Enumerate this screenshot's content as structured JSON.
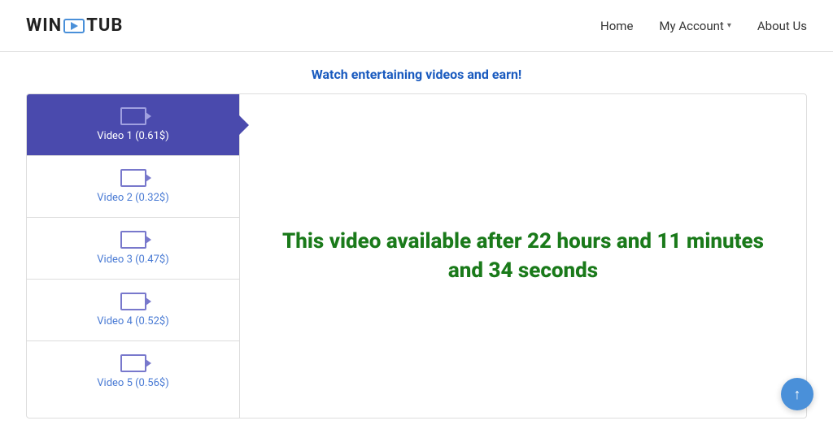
{
  "header": {
    "logo_win": "WIN",
    "logo_tub": "TUB",
    "nav": {
      "home": "Home",
      "my_account": "My Account",
      "about_us": "About Us"
    }
  },
  "tagline": "Watch entertaining videos and earn!",
  "videos": [
    {
      "label": "Video 1 (0.61$)",
      "active": true
    },
    {
      "label": "Video 2 (0.32$)",
      "active": false
    },
    {
      "label": "Video 3 (0.47$)",
      "active": false
    },
    {
      "label": "Video 4 (0.52$)",
      "active": false
    },
    {
      "label": "Video 5 (0.56$)",
      "active": false
    }
  ],
  "availability": {
    "message": "This video available after 22 hours and 11 minutes and 34 seconds"
  },
  "scroll_top_label": "↑"
}
